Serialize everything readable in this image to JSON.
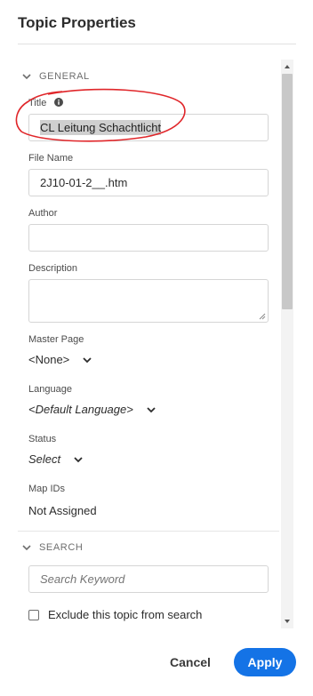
{
  "dialog": {
    "title": "Topic Properties"
  },
  "general": {
    "section_label": "GENERAL",
    "title_label": "Title",
    "title_value": "CL Leitung Schachtlicht",
    "file_name_label": "File Name",
    "file_name_value": "2J10-01-2__.htm",
    "author_label": "Author",
    "author_value": "",
    "description_label": "Description",
    "master_page_label": "Master Page",
    "master_page_value": "<None>",
    "language_label": "Language",
    "language_value": "<Default Language>",
    "status_label": "Status",
    "status_value": "Select",
    "map_ids_label": "Map IDs",
    "map_ids_value": "Not Assigned"
  },
  "search": {
    "section_label": "SEARCH",
    "keyword_placeholder": "Search Keyword",
    "exclude_label": "Exclude this topic from search"
  },
  "footer": {
    "cancel_label": "Cancel",
    "apply_label": "Apply"
  },
  "colors": {
    "accent": "#1473e6",
    "annotation": "#e0262a"
  }
}
